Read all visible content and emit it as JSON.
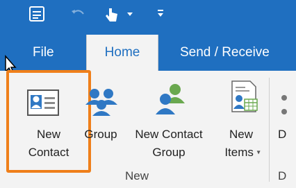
{
  "tabs": [
    {
      "label": "File"
    },
    {
      "label": "Home"
    },
    {
      "label": "Send / Receive"
    }
  ],
  "ribbon": {
    "buttons": {
      "new_contact": {
        "line1": "New",
        "line2": "Contact"
      },
      "group": {
        "line1": "Group"
      },
      "new_contact_group": {
        "line1": "New Contact",
        "line2": "Group"
      },
      "new_items": {
        "line1": "New",
        "line2": "Items"
      },
      "cut_partial": {
        "line1": "D"
      }
    },
    "group_label": "New",
    "cut_group_label": "D"
  },
  "colors": {
    "brand_blue": "#1f6fc0",
    "highlight_orange": "#ef7f1a",
    "people_icon_blue": "#2f78c4",
    "people_icon_green": "#6aa84f"
  }
}
